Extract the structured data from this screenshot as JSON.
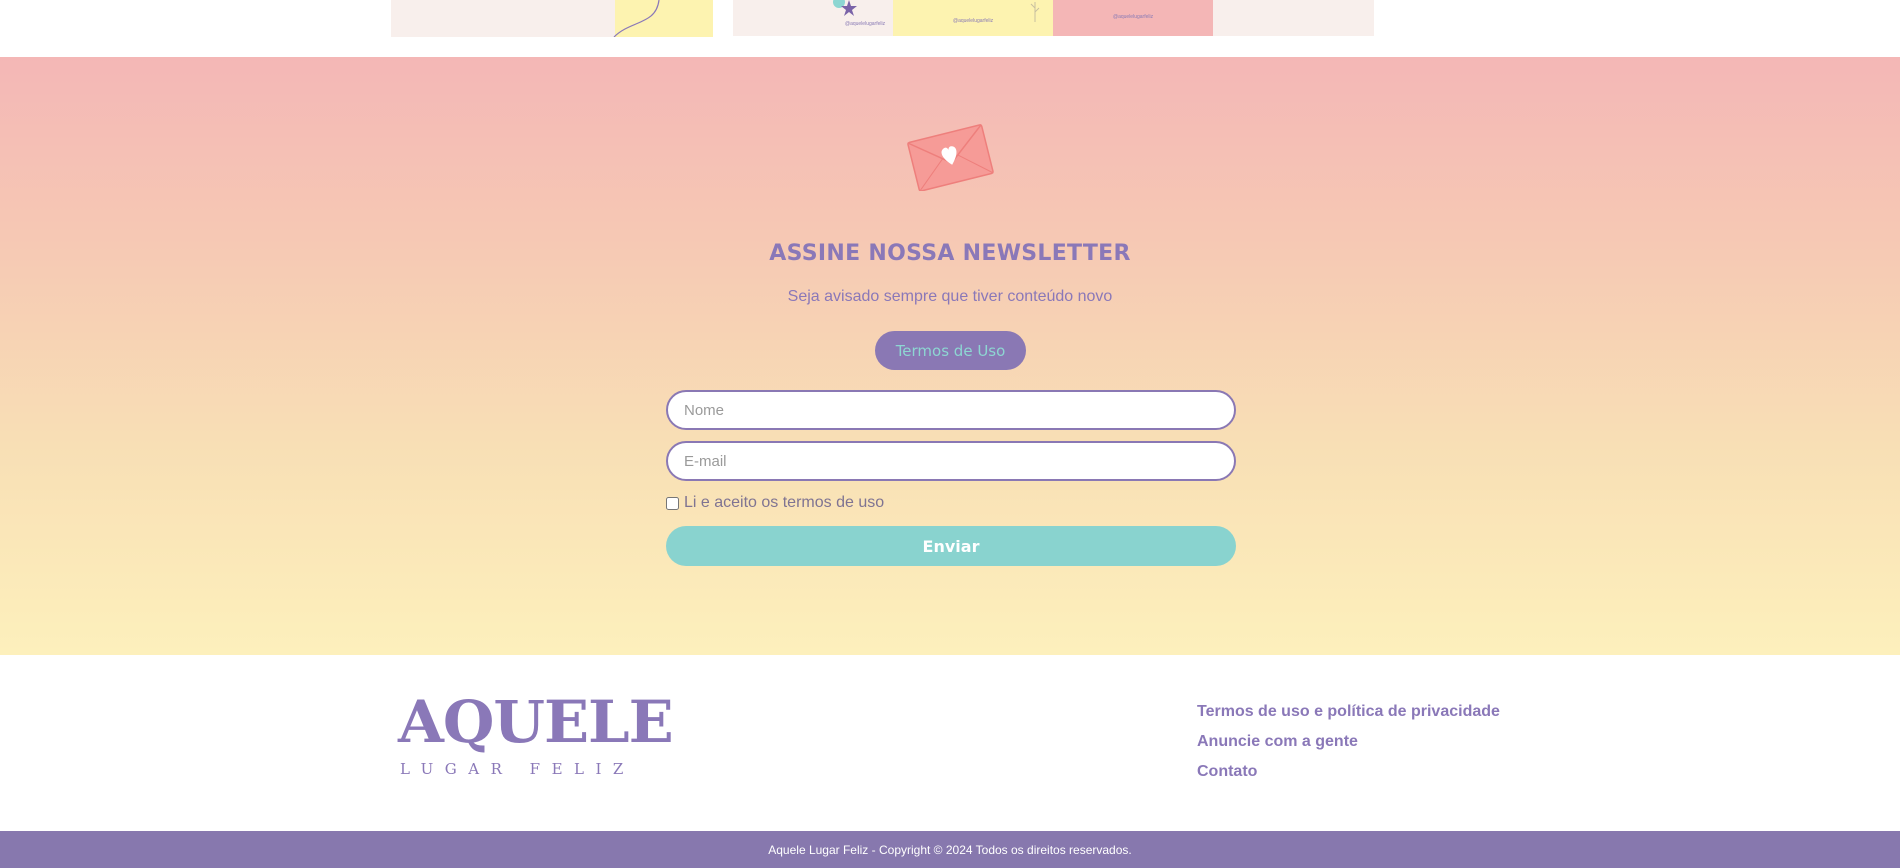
{
  "colors": {
    "brand_purple": "#8a78b8",
    "accent_teal": "#89d3cf",
    "gradient_top": "#f4b7b6",
    "gradient_bottom": "#fdf0bc",
    "footer_bar": "#8778ae"
  },
  "top_strip": {
    "card_handles": [
      "@aquelelugarfeliz",
      "@aquelelugarfeliz",
      "@aquelelugarfeliz"
    ]
  },
  "newsletter": {
    "icon": "envelope-heart-icon",
    "title": "ASSINE NOSSA NEWSLETTER",
    "subtitle": "Seja avisado sempre que tiver conteúdo novo",
    "terms_button": "Termos de Uso",
    "name_placeholder": "Nome",
    "email_placeholder": "E-mail",
    "consent_label": "Li e aceito os termos de uso",
    "submit_label": "Enviar"
  },
  "footer": {
    "logo_main": "AQUELE",
    "logo_sub": "LUGAR FELIZ",
    "links": [
      "Termos de uso e política de privacidade",
      "Anuncie com a gente",
      "Contato"
    ]
  },
  "copyright": "Aquele Lugar Feliz - Copyright © 2024 Todos os direitos reservados."
}
